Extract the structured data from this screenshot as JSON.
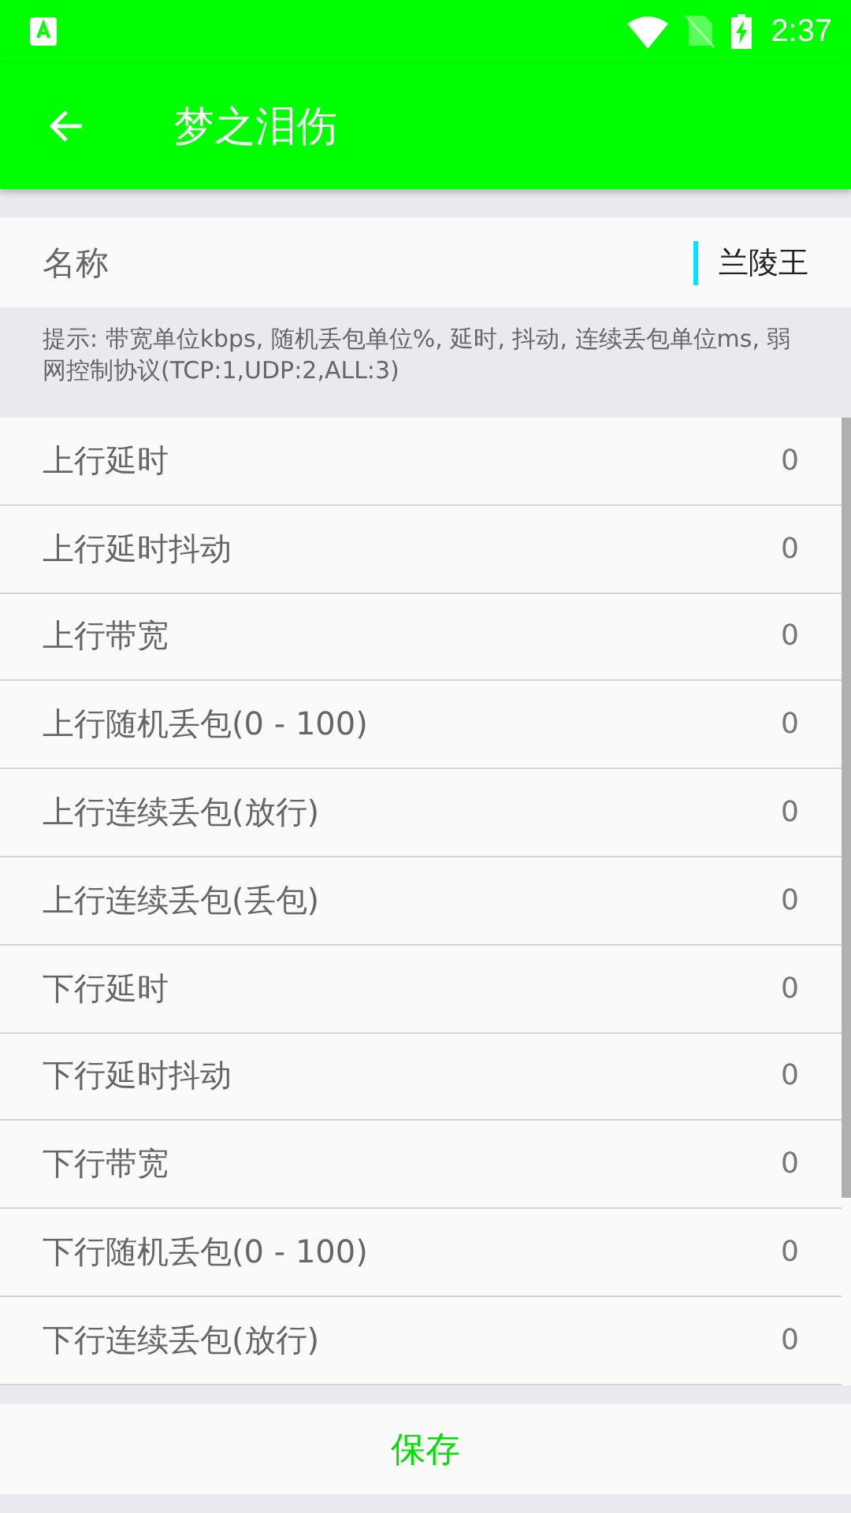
{
  "status_bar": {
    "time": "2:37"
  },
  "toolbar": {
    "title": "梦之泪伤"
  },
  "name_field": {
    "label": "名称",
    "value": "兰陵王"
  },
  "hint": "提示: 带宽单位kbps, 随机丢包单位%, 延时, 抖动, 连续丢包单位ms, 弱网控制协议(TCP:1,UDP:2,ALL:3)",
  "settings": [
    {
      "label": "上行延时",
      "value": "0"
    },
    {
      "label": "上行延时抖动",
      "value": "0"
    },
    {
      "label": "上行带宽",
      "value": "0"
    },
    {
      "label": "上行随机丢包(0 - 100)",
      "value": "0"
    },
    {
      "label": "上行连续丢包(放行)",
      "value": "0"
    },
    {
      "label": "上行连续丢包(丢包)",
      "value": "0"
    },
    {
      "label": "下行延时",
      "value": "0"
    },
    {
      "label": "下行延时抖动",
      "value": "0"
    },
    {
      "label": "下行带宽",
      "value": "0"
    },
    {
      "label": "下行随机丢包(0 - 100)",
      "value": "0"
    },
    {
      "label": "下行连续丢包(放行)",
      "value": "0"
    }
  ],
  "save_button": "保存"
}
